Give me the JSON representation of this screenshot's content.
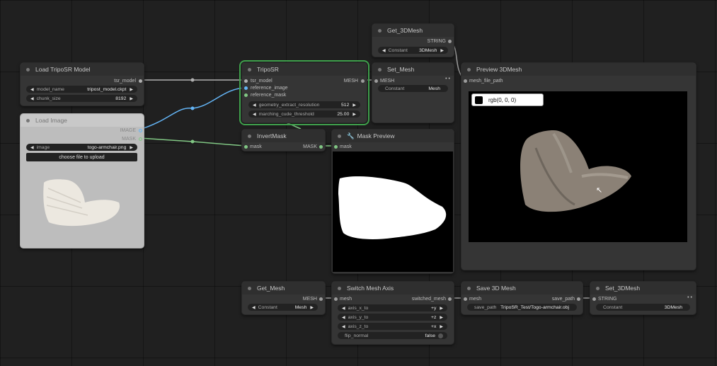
{
  "nodes": {
    "get_3dmesh": {
      "title": "Get_3DMesh",
      "output": "STRING",
      "widget_label": "Constant",
      "widget_value": "3DMesh"
    },
    "load_model": {
      "title": "Load TripoSR Model",
      "output": "tsr_model",
      "widgets": [
        {
          "label": "model_name",
          "value": "tripost_model.ckpt"
        },
        {
          "label": "chunk_size",
          "value": "8192"
        }
      ]
    },
    "triposr": {
      "title": "TripoSR",
      "inputs": [
        "tsr_model",
        "reference_image",
        "reference_mask"
      ],
      "output": "MESH",
      "widgets": [
        {
          "label": "geometry_extract_resolution",
          "value": "512"
        },
        {
          "label": "marching_cude_threshold",
          "value": "25.00"
        }
      ]
    },
    "set_mesh": {
      "title": "Set_Mesh",
      "input": "MESH",
      "widget_label": "Constant",
      "widget_value": "Mesh"
    },
    "preview_3d": {
      "title": "Preview 3DMesh",
      "input": "mesh_file_path",
      "tooltip": "rgb(0, 0, 0)"
    },
    "load_image": {
      "title": "Load Image",
      "outputs": [
        "IMAGE",
        "MASK"
      ],
      "widget_label": "image",
      "widget_value": "togo-armchair.png",
      "button": "choose file to upload"
    },
    "invert_mask": {
      "title": "InvertMask",
      "input": "mask",
      "output": "MASK"
    },
    "mask_preview": {
      "title": "Mask Preview",
      "input": "mask"
    },
    "get_mesh": {
      "title": "Get_Mesh",
      "output": "MESH",
      "widget_label": "Constant",
      "widget_value": "Mesh"
    },
    "switch_axis": {
      "title": "Switch Mesh Axis",
      "input": "mesh",
      "output": "switched_mesh",
      "widgets": [
        {
          "label": "axis_x_to",
          "value": "+y"
        },
        {
          "label": "axis_y_to",
          "value": "+z"
        },
        {
          "label": "axis_z_to",
          "value": "+x"
        }
      ],
      "toggle_label": "flip_normal",
      "toggle_value": "false"
    },
    "save_3d": {
      "title": "Save 3D Mesh",
      "input": "mesh",
      "output": "save_path",
      "widget_label": "save_path",
      "widget_value": "TripoSR_Test/Togo-armchair.obj"
    },
    "set_3dmesh": {
      "title": "Set_3DMesh",
      "input": "STRING",
      "widget_label": "Constant",
      "widget_value": "3DMesh"
    }
  },
  "colors": {
    "mesh_wire": "#9c9c9c",
    "image_wire": "#64b5f6",
    "mask_wire": "#81c784",
    "model_wire": "#b0b0b0",
    "selected": "#3fa04c"
  },
  "icons": {
    "mask_preview": "wrench-icon",
    "collapse_dot": "dot-icon"
  }
}
